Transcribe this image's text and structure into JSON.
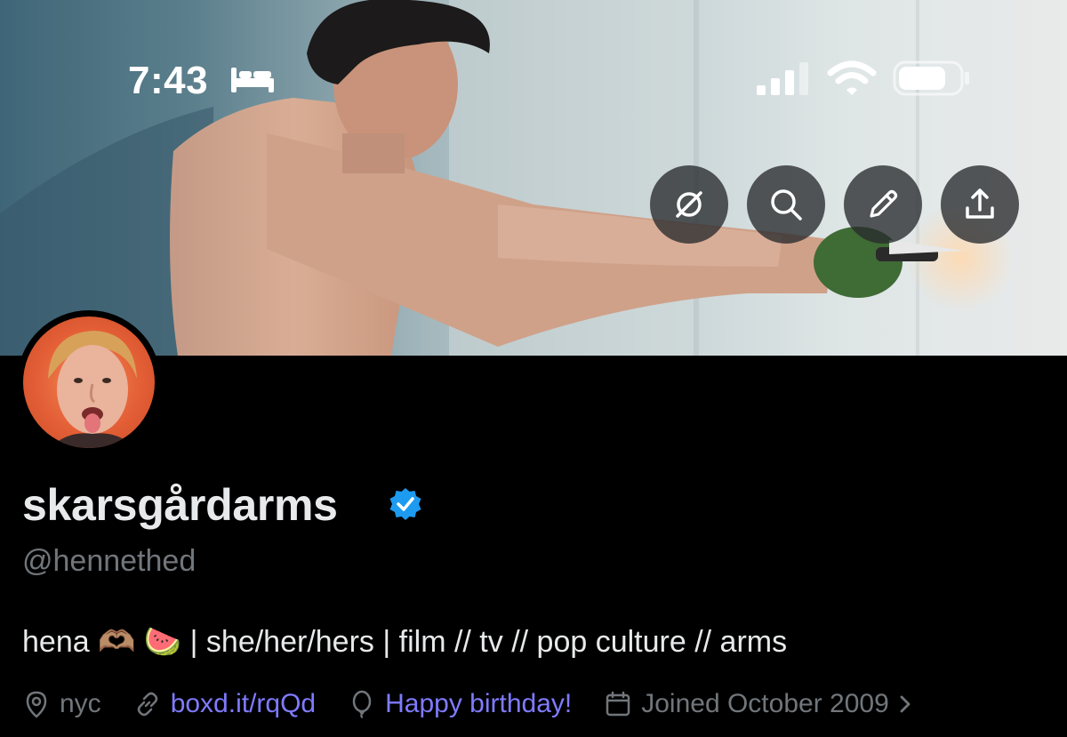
{
  "status_bar": {
    "time": "7:43",
    "icons": [
      "bed-icon",
      "cellular-signal-icon",
      "wifi-icon",
      "battery-icon"
    ]
  },
  "header_actions": [
    {
      "name": "grok-icon"
    },
    {
      "name": "search-icon"
    },
    {
      "name": "edit-icon"
    },
    {
      "name": "share-icon"
    }
  ],
  "profile": {
    "display_name": "skarsgårdarms",
    "verified": true,
    "handle": "@hennethed",
    "bio": "hena 🫶🏽 🍉 | she/her/hers | film // tv // pop culture // arms",
    "location": "nyc",
    "website": "boxd.it/rqQd",
    "birthday": "Happy birthday!",
    "joined": "Joined October 2009"
  },
  "colors": {
    "background": "#000000",
    "primary_text": "#e7e9ea",
    "secondary_text": "#71767b",
    "link": "#7f7bff",
    "verified_badge": "#1d9bf0"
  }
}
